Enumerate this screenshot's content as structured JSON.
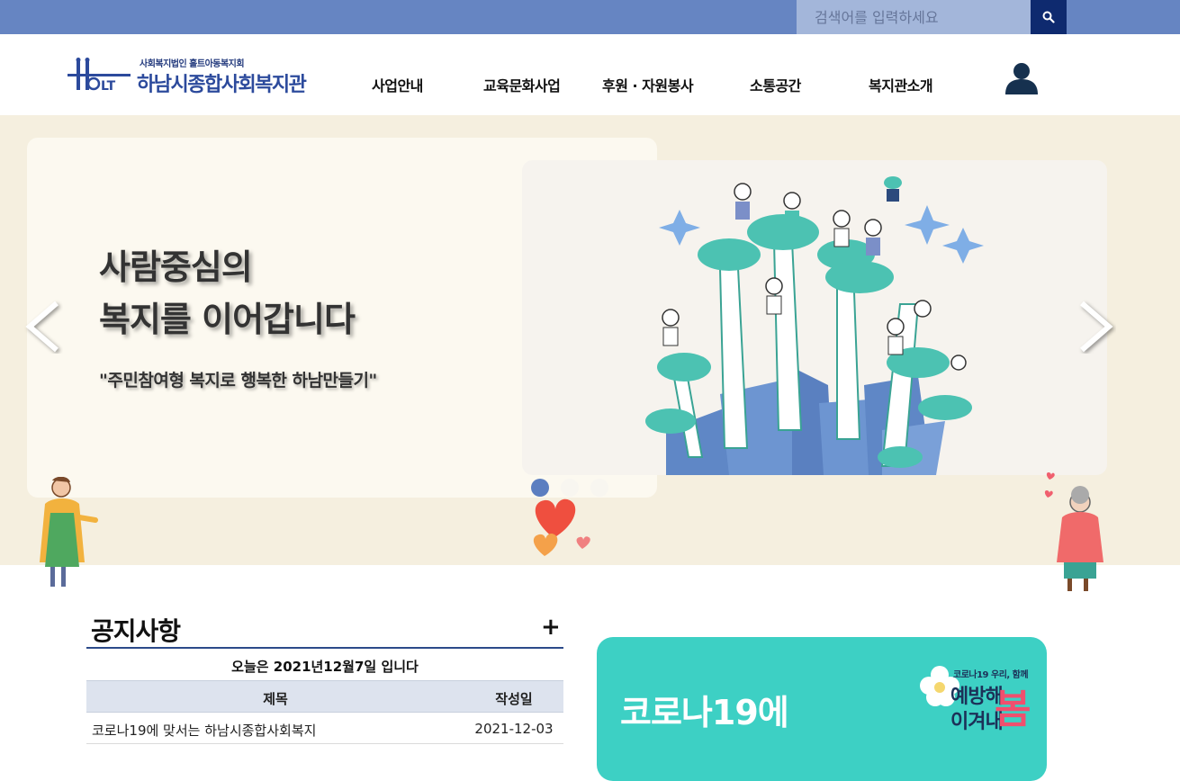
{
  "search": {
    "placeholder": "검색어를 입력하세요"
  },
  "header": {
    "logo_subtitle": "사회복지법인 홀트아동복지회",
    "logo_title": "하남시종합사회복지관",
    "nav": [
      {
        "label": "사업안내"
      },
      {
        "label": "교육문화사업"
      },
      {
        "label": "후원 · 자원봉사"
      },
      {
        "label": "소통공간"
      },
      {
        "label": "복지관소개"
      }
    ]
  },
  "hero": {
    "title_line1": "사람중심의",
    "title_line2": "복지를 이어갑니다",
    "subtitle": "\"주민참여형 복지로 행복한 하남만들기\"",
    "active_slide": 1,
    "slide_count": 3
  },
  "notice": {
    "title": "공지사항",
    "more": "+",
    "today": "오늘은  2021년12월7일  입니다",
    "col_title": "제목",
    "col_date": "작성일",
    "rows": [
      {
        "title": "코로나19에 맞서는 하남시종합사회복지",
        "date": "2021-12-03"
      }
    ]
  },
  "covid_banner": {
    "title_line1": "코로나19에",
    "badge_sub": "코로나19 우리, 함께",
    "badge_line1": "예방해",
    "badge_line2": "이겨내",
    "badge_big": "봄"
  },
  "colors": {
    "topbar": "#6685c2",
    "search_button": "#0e2a6f",
    "hero_bg": "#f5efdf",
    "covid_bg": "#3dd0c4",
    "accent_red": "#f04f6e"
  }
}
